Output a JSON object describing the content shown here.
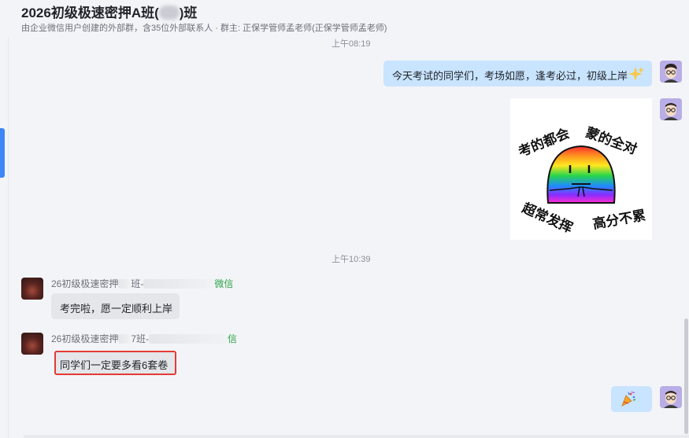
{
  "header": {
    "title_prefix": "2026初级极速密押A班(",
    "title_suffix": ")班",
    "subtitle": "由企业微信用户创建的外部群，含35位外部联系人 · 群主: 正保学管师孟老师(正保学管师孟老师)"
  },
  "messages": {
    "timestamp_1": "上午08:19",
    "me_text_1": "今天考试的同学们，考场如愿，逢考必过，初级上岸",
    "sticker": {
      "top_left": "考的都会",
      "top_right": "蒙的全对",
      "bottom_left": "超常发挥",
      "bottom_right": "高分不累"
    },
    "timestamp_2": "上午10:39",
    "other_1": {
      "sender_prefix": "26初级极速密押",
      "sender_mid": "班-",
      "sender_tag": "微信",
      "text": "考完啦，愿一定顺利上岸"
    },
    "other_2": {
      "sender_prefix": "26初级极速密押",
      "sender_mid": "7班-",
      "sender_tag": "信",
      "text": "同学们一定要多看6套卷"
    }
  },
  "icons": [
    "sparkles-icon",
    "party-popper-icon"
  ],
  "colors": {
    "my_bubble": "#c9e4ff",
    "other_bubble": "#e4e6ea",
    "wechat_tag": "#2ba245",
    "highlight": "#e53935",
    "accent": "#3d86f6"
  }
}
